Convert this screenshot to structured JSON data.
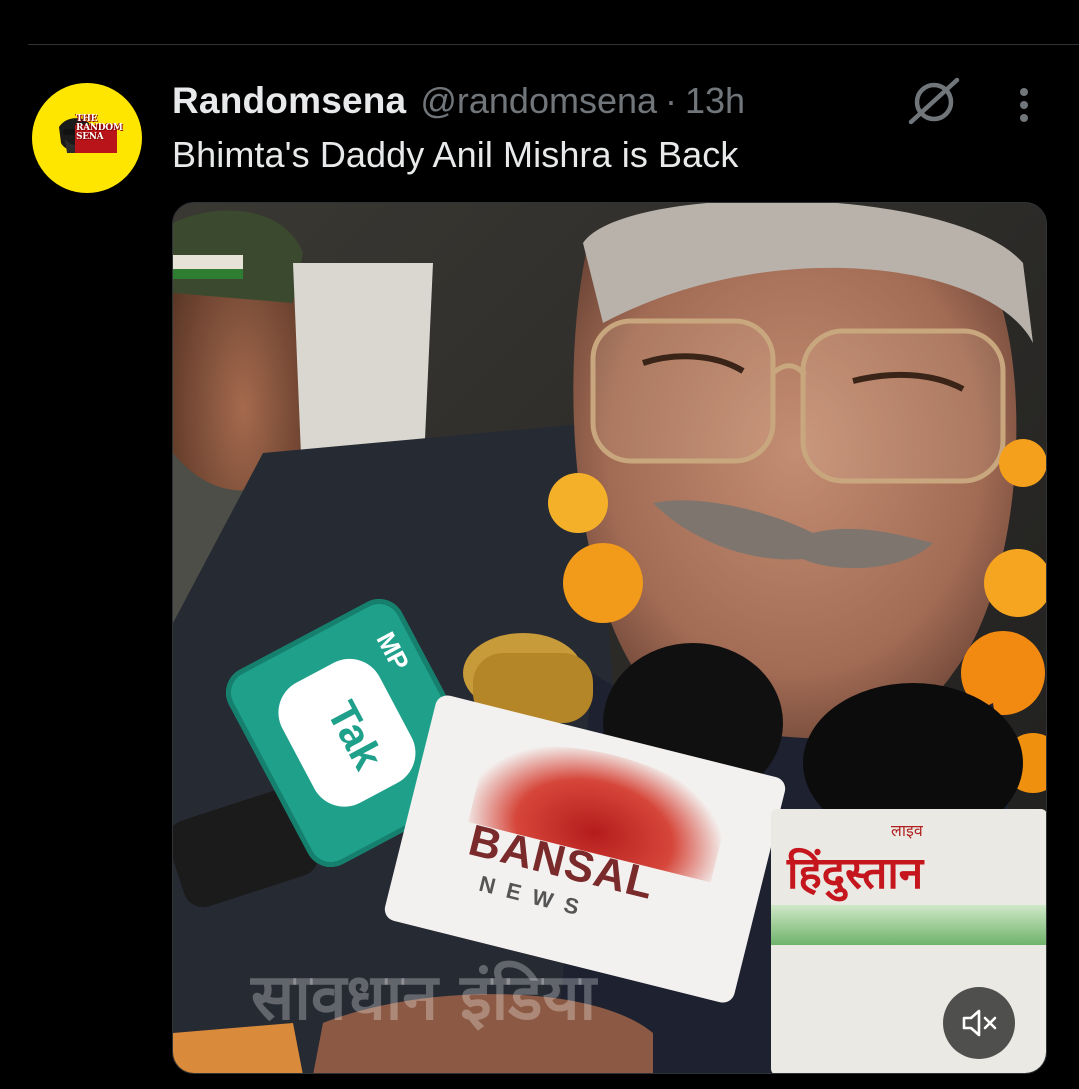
{
  "tweet": {
    "display_name": "Randomsena",
    "handle": "@randomsena",
    "separator": "·",
    "timestamp": "13h",
    "text": "Bhimta's Daddy Anil Mishra is Back",
    "avatar": {
      "logo_text": "THE RANDOM SENA",
      "background_color": "#ffe600"
    },
    "actions": {
      "grok_icon": "grok-icon",
      "more_icon": "more-dots-icon"
    }
  },
  "media": {
    "type": "video",
    "mic_labels": {
      "mp_tak_brand": "Tak",
      "mp_tak_prefix": "MP",
      "bansal_brand": "BANSAL",
      "bansal_sub": "NEWS",
      "hindustan_top": "लाइव",
      "hindustan_brand": "हिंदुस्तान"
    },
    "watermark": "सावधान इंडिया",
    "mute_icon": "speaker-muted-icon"
  },
  "colors": {
    "background": "#000000",
    "text_primary": "#e7e9ea",
    "text_secondary": "#71767b",
    "divider": "#2f3336"
  }
}
